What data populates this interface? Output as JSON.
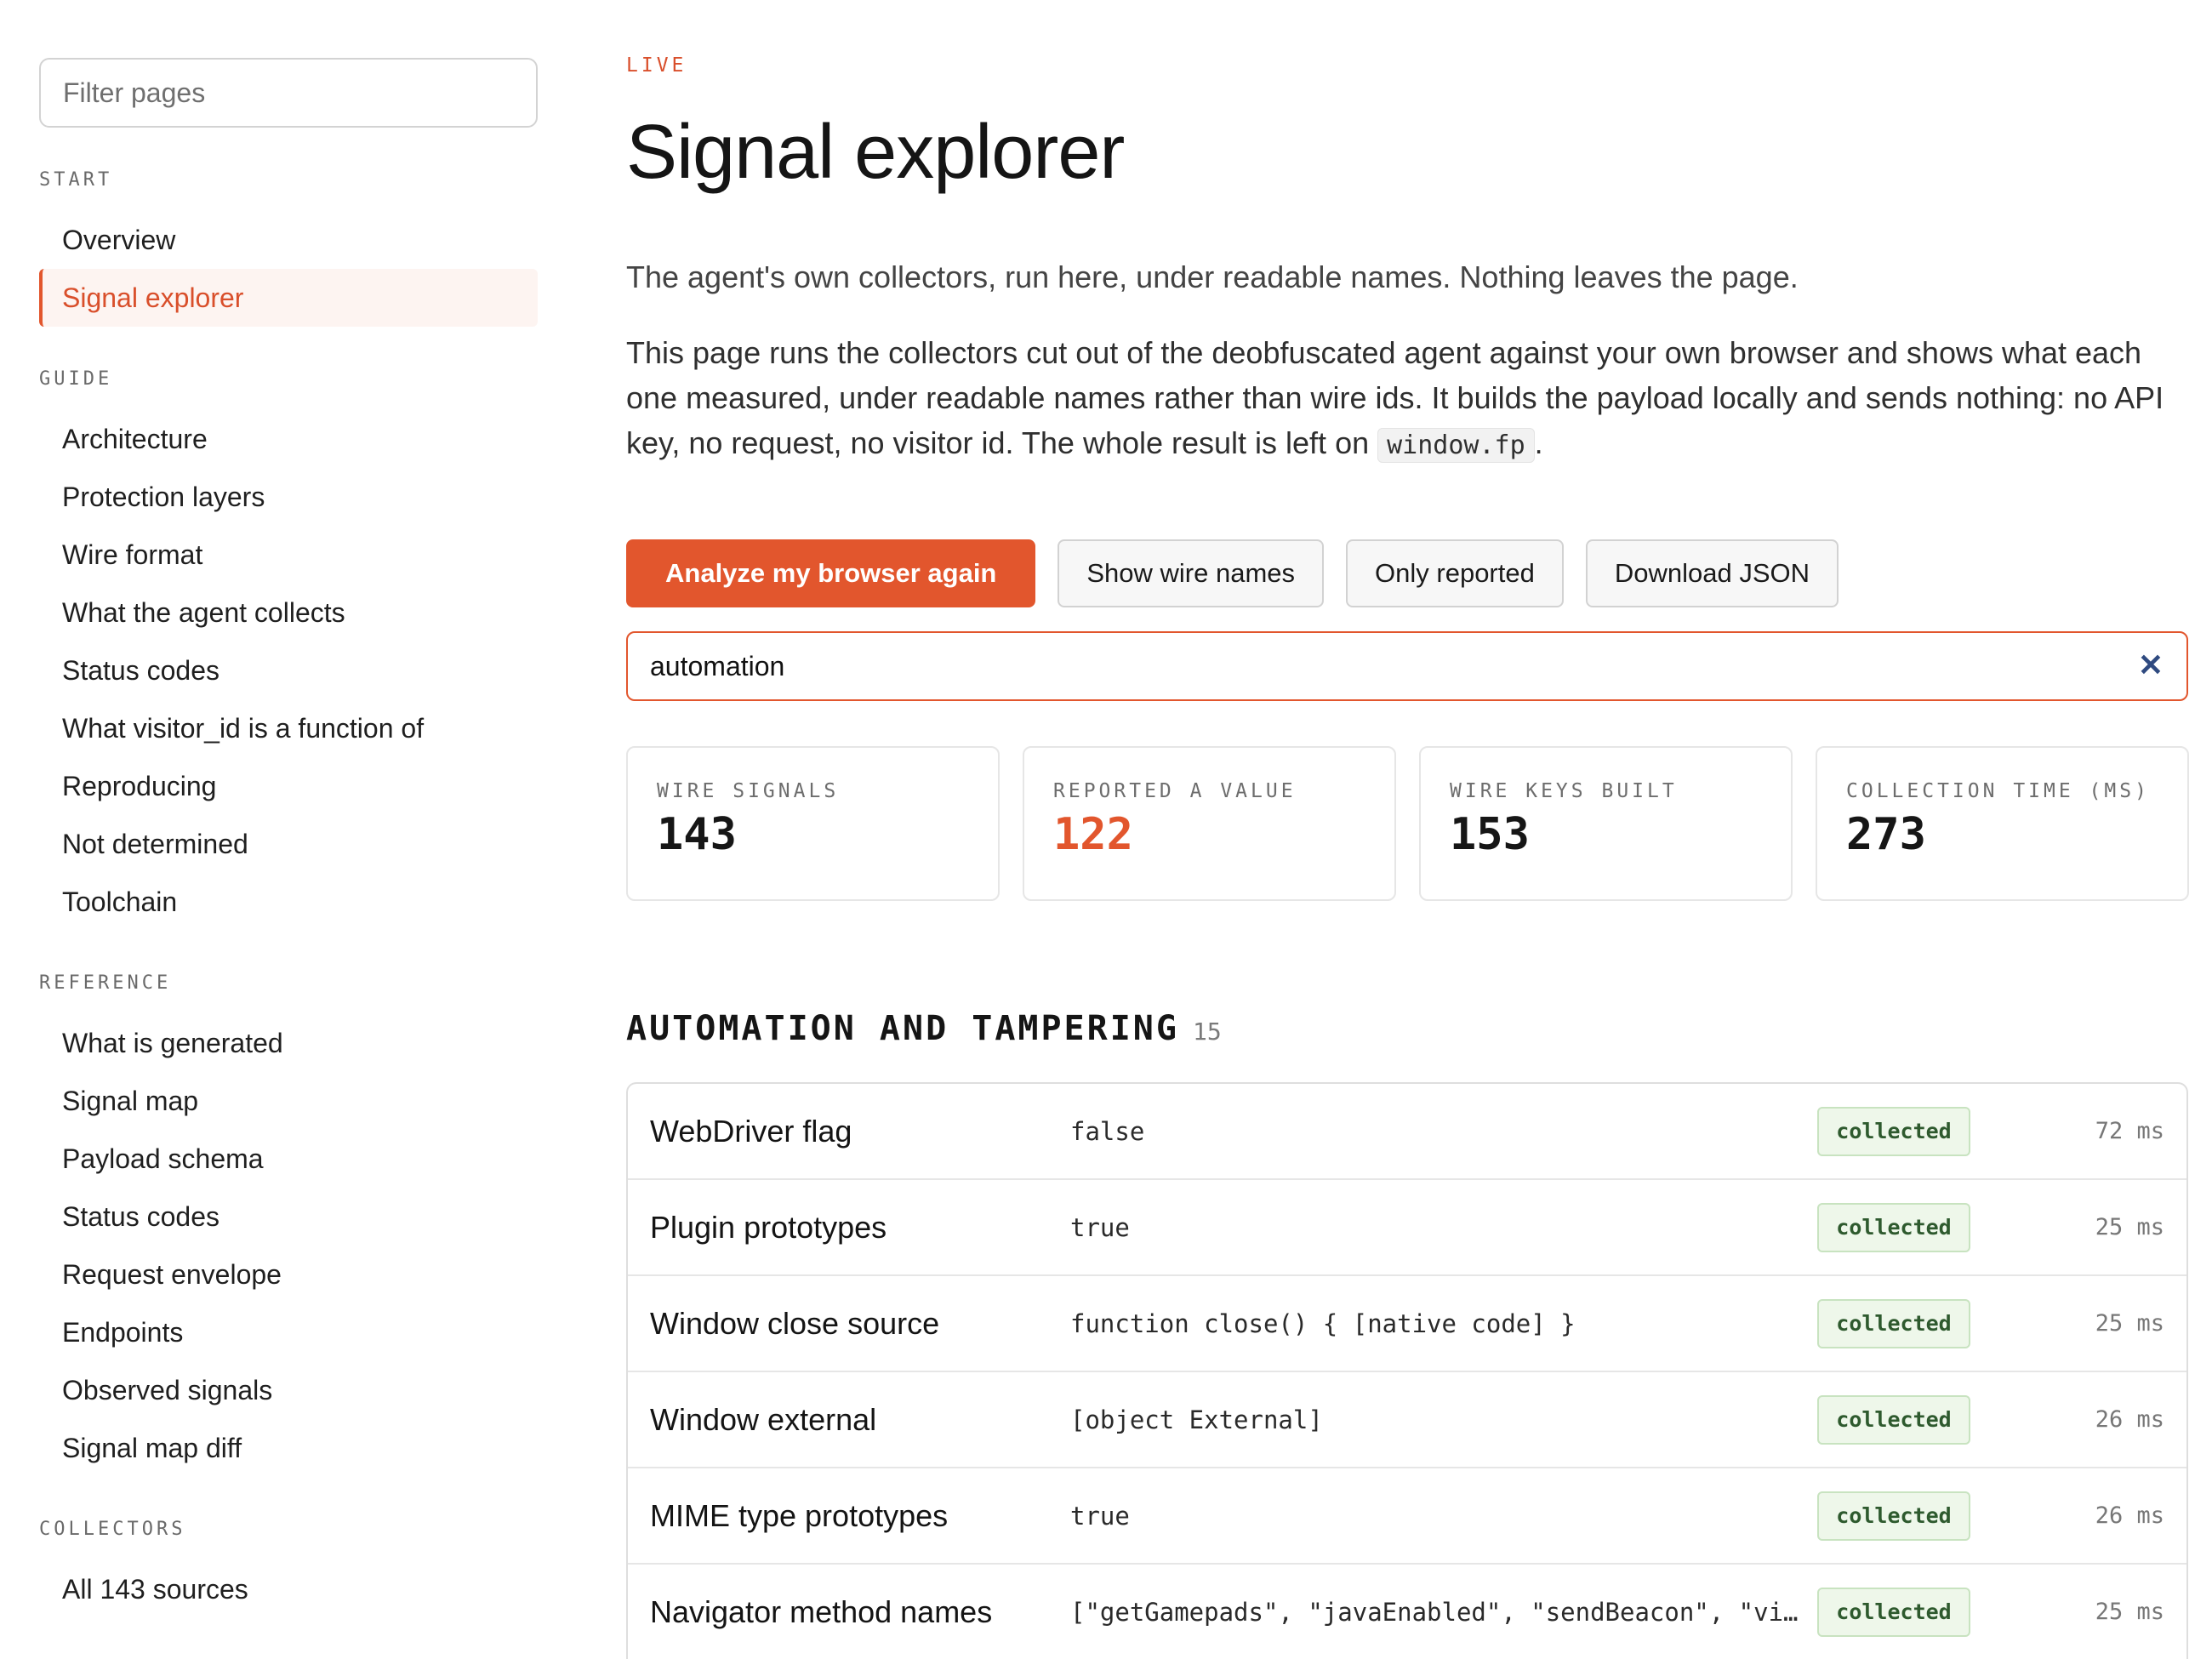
{
  "sidebar": {
    "filter_placeholder": "Filter pages",
    "sections": [
      {
        "heading": "START",
        "items": [
          {
            "label": "Overview",
            "active": false
          },
          {
            "label": "Signal explorer",
            "active": true
          }
        ]
      },
      {
        "heading": "GUIDE",
        "items": [
          {
            "label": "Architecture"
          },
          {
            "label": "Protection layers"
          },
          {
            "label": "Wire format"
          },
          {
            "label": "What the agent collects"
          },
          {
            "label": "Status codes"
          },
          {
            "label": "What visitor_id is a function of"
          },
          {
            "label": "Reproducing"
          },
          {
            "label": "Not determined"
          },
          {
            "label": "Toolchain"
          }
        ]
      },
      {
        "heading": "REFERENCE",
        "items": [
          {
            "label": "What is generated"
          },
          {
            "label": "Signal map"
          },
          {
            "label": "Payload schema"
          },
          {
            "label": "Status codes"
          },
          {
            "label": "Request envelope"
          },
          {
            "label": "Endpoints"
          },
          {
            "label": "Observed signals"
          },
          {
            "label": "Signal map diff"
          }
        ]
      },
      {
        "heading": "COLLECTORS",
        "items": [
          {
            "label": "All 143 sources"
          }
        ]
      }
    ]
  },
  "header": {
    "eyebrow": "LIVE",
    "title": "Signal explorer",
    "lede": "The agent's own collectors, run here, under readable names. Nothing leaves the page.",
    "body_before": "This page runs the collectors cut out of the deobfuscated agent against your own browser and shows what each one measured, under readable names rather than wire ids. It builds the payload locally and sends nothing: no API key, no request, no visitor id. The whole result is left on ",
    "body_code": "window.fp",
    "body_after": "."
  },
  "toolbar": {
    "analyze_label": "Analyze my browser again",
    "wire_names_label": "Show wire names",
    "only_reported_label": "Only reported",
    "download_label": "Download JSON"
  },
  "search": {
    "value": "automation",
    "clear_glyph": "✕"
  },
  "stats": [
    {
      "label": "WIRE SIGNALS",
      "value": "143",
      "accent": false
    },
    {
      "label": "REPORTED A VALUE",
      "value": "122",
      "accent": true
    },
    {
      "label": "WIRE KEYS BUILT",
      "value": "153",
      "accent": false
    },
    {
      "label": "COLLECTION TIME (MS)",
      "value": "273",
      "accent": false
    }
  ],
  "section": {
    "title": "AUTOMATION AND TAMPERING",
    "count": "15",
    "rows": [
      {
        "name": "WebDriver flag",
        "value": "false",
        "status": "collected",
        "time": "72 ms"
      },
      {
        "name": "Plugin prototypes",
        "value": "true",
        "status": "collected",
        "time": "25 ms"
      },
      {
        "name": "Window close source",
        "value": "function close() { [native code] }",
        "status": "collected",
        "time": "25 ms"
      },
      {
        "name": "Window external",
        "value": "[object External]",
        "status": "collected",
        "time": "26 ms"
      },
      {
        "name": "MIME type prototypes",
        "value": "true",
        "status": "collected",
        "time": "26 ms"
      },
      {
        "name": "Navigator method names",
        "value": "[\"getGamepads\", \"javaEnabled\", \"sendBeacon\", \"vi…",
        "status": "collected",
        "time": "25 ms"
      }
    ]
  },
  "colors": {
    "accent": "#e2562d",
    "badge_bg": "#eef7ea",
    "badge_text": "#2e5a2e"
  }
}
